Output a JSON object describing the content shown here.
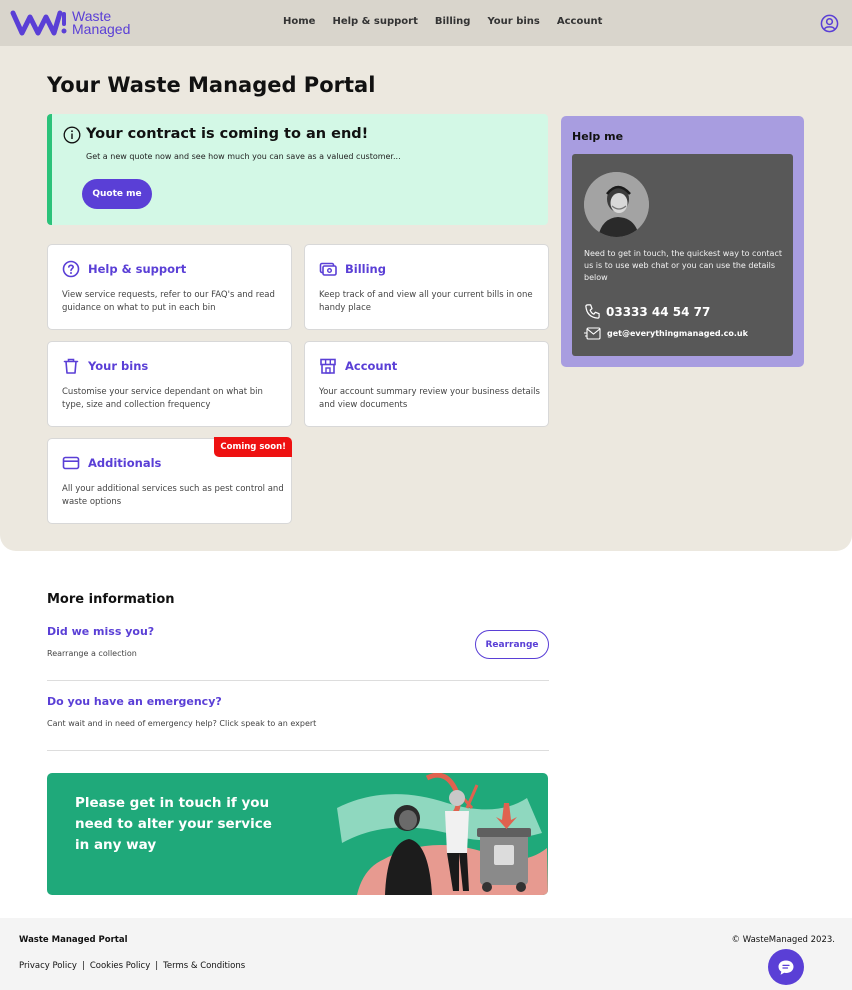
{
  "header": {
    "logo_line1": "Waste",
    "logo_line2": "Managed",
    "nav": [
      "Home",
      "Help & support",
      "Billing",
      "Your bins",
      "Account"
    ]
  },
  "page_title": "Your Waste Managed Portal",
  "alert": {
    "title": "Your contract is coming to an end!",
    "text": "Get a new quote now and see how much you can save as a valued customer...",
    "button": "Quote me"
  },
  "cards": [
    {
      "title": "Help & support",
      "desc": "View service requests, refer to our FAQ's and read guidance on what to put in each bin"
    },
    {
      "title": "Billing",
      "desc": "Keep track of and view all your current bills in one handy place"
    },
    {
      "title": "Your bins",
      "desc": "Customise your service dependant on what bin type, size and collection frequency"
    },
    {
      "title": "Account",
      "desc": "Your account summary review your business details and view documents"
    },
    {
      "title": "Additionals",
      "desc": "All your additional services such as pest control and waste options",
      "badge": "Coming soon!"
    }
  ],
  "help": {
    "title": "Help me",
    "text": "Need to get in touch, the quickest way to contact us is to use web chat or you can use the details below",
    "phone": "03333 44 54 77",
    "email": "get@everythingmanaged.co.uk"
  },
  "more_info": {
    "title": "More information",
    "items": [
      {
        "title": "Did we miss you?",
        "desc": "Rearrange a collection",
        "button": "Rearrange"
      },
      {
        "title": "Do you have an emergency?",
        "desc": "Cant wait and in need of emergency help? Click speak to an expert"
      }
    ]
  },
  "banner": {
    "text": "Please get in touch if you need to alter your service in any way"
  },
  "footer": {
    "title": "Waste Managed Portal",
    "links": [
      "Privacy Policy",
      "Cookies Policy",
      "Terms & Conditions"
    ],
    "separator": "|",
    "copyright": "© WasteManaged 2023."
  },
  "colors": {
    "brand": "#5a3fd6",
    "header_bg": "#d9d5cc",
    "hero_bg": "#ece8df",
    "alert_bg": "#d3f8e6",
    "alert_accent": "#2bc27a",
    "help_panel": "#a89de0",
    "banner_bg": "#1fa97a",
    "badge": "#ee1111"
  }
}
